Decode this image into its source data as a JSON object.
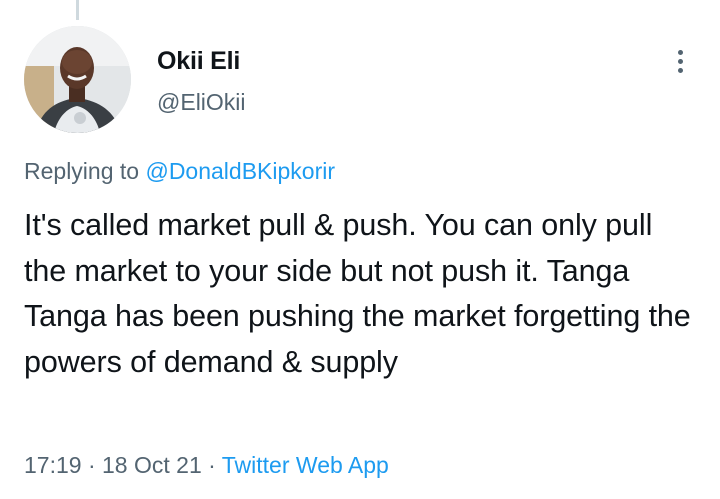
{
  "tweet": {
    "author_name": "Okii Eli",
    "author_handle": "@EliOkii",
    "reply_prefix": "Replying to ",
    "reply_to": "@DonaldBKipkorir",
    "text": "It's called market pull & push. You can only pull the market to your side but not push it. Tanga Tanga has been pushing the market forgetting the powers of demand & supply",
    "time": "17:19",
    "separator": " · ",
    "date": "18 Oct 21",
    "source": "Twitter Web App"
  },
  "icons": {
    "more": "more-vertical-icon",
    "avatar": "avatar"
  },
  "colors": {
    "link": "#1d9bf0",
    "secondary_text": "#536471",
    "primary_text": "#0f1419"
  }
}
